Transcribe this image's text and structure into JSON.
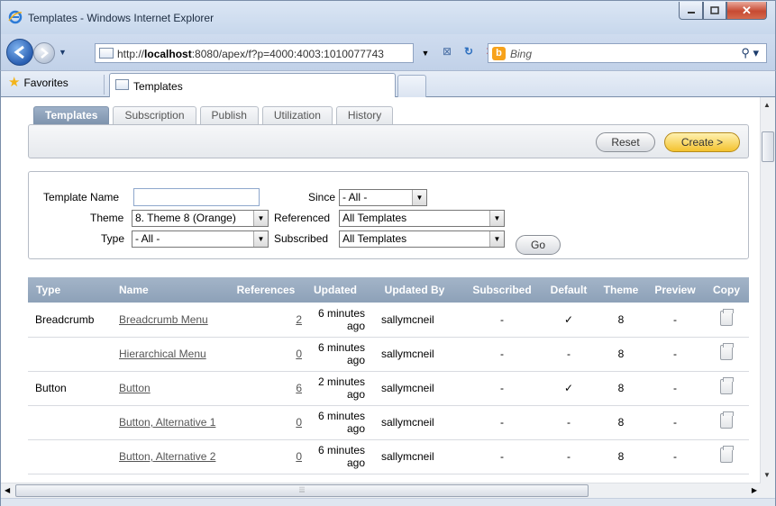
{
  "window": {
    "title": "Templates - Windows Internet Explorer"
  },
  "address": {
    "url_prefix": "http://",
    "url_host": "localhost",
    "url_rest": ":8080/apex/f?p=4000:4003:1010077743",
    "search_placeholder": "Bing"
  },
  "favorites": {
    "label": "Favorites",
    "tab_label": "Templates"
  },
  "apex_tabs": [
    "Templates",
    "Subscription",
    "Publish",
    "Utilization",
    "History"
  ],
  "toolbar": {
    "reset_label": "Reset",
    "create_label": "Create >"
  },
  "filters": {
    "template_name_label": "Template Name",
    "template_name_value": "",
    "theme_label": "Theme",
    "theme_value": "8. Theme 8 (Orange)",
    "type_label": "Type",
    "type_value": "- All -",
    "since_label": "Since",
    "since_value": "- All -",
    "referenced_label": "Referenced",
    "referenced_value": "All Templates",
    "subscribed_label": "Subscribed",
    "subscribed_value": "All Templates",
    "go_label": "Go"
  },
  "table": {
    "headers": [
      "Type",
      "Name",
      "References",
      "Updated",
      "Updated By",
      "Subscribed",
      "Default",
      "Theme",
      "Preview",
      "Copy"
    ],
    "rows": [
      {
        "type": "Breadcrumb",
        "name": "Breadcrumb Menu",
        "references": "2",
        "updated": "6 minutes ago",
        "updated_by": "sallymcneil",
        "subscribed": "-",
        "default": "✓",
        "theme": "8",
        "preview": "-"
      },
      {
        "type": "",
        "name": "Hierarchical Menu",
        "references": "0",
        "updated": "6 minutes ago",
        "updated_by": "sallymcneil",
        "subscribed": "-",
        "default": "-",
        "theme": "8",
        "preview": "-"
      },
      {
        "type": "Button",
        "name": "Button",
        "references": "6",
        "updated": "2 minutes ago",
        "updated_by": "sallymcneil",
        "subscribed": "-",
        "default": "✓",
        "theme": "8",
        "preview": "-"
      },
      {
        "type": "",
        "name": "Button, Alternative 1",
        "references": "0",
        "updated": "6 minutes ago",
        "updated_by": "sallymcneil",
        "subscribed": "-",
        "default": "-",
        "theme": "8",
        "preview": "-"
      },
      {
        "type": "",
        "name": "Button, Alternative 2",
        "references": "0",
        "updated": "6 minutes ago",
        "updated_by": "sallymcneil",
        "subscribed": "-",
        "default": "-",
        "theme": "8",
        "preview": "-"
      }
    ]
  },
  "icons": {
    "copy": "copy-icon",
    "search": "search-icon",
    "favorites": "star-icon"
  }
}
